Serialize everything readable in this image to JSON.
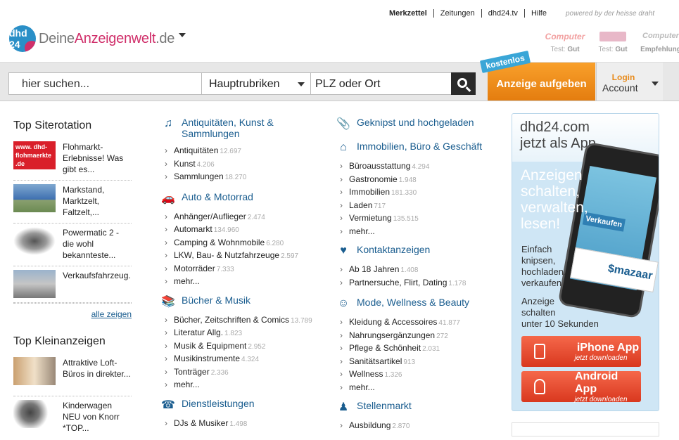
{
  "topnav": {
    "items": [
      "Merkzettel",
      "Zeitungen",
      "dhd24.tv",
      "Hilfe"
    ],
    "powered": "powered by der heisse draht"
  },
  "logo": {
    "badge": "dhd 24",
    "text_a": "Deine",
    "text_b": "Anzeigenwelt",
    "text_c": ".de"
  },
  "tests": [
    {
      "badge": "Computer",
      "label": "Test:",
      "rating": "Gut"
    },
    {
      "badge": "",
      "label": "Test:",
      "rating": "Gut"
    },
    {
      "badge": "Computer",
      "label": "",
      "rating": "Empfehlung"
    }
  ],
  "search": {
    "placeholder": "hier suchen...",
    "rubrik": "Hauptrubriken",
    "plz_placeholder": "PLZ oder Ort"
  },
  "cta": {
    "label": "Anzeige aufgeben",
    "badge": "kostenlos"
  },
  "login": {
    "line1": "Login",
    "line2": "Account"
  },
  "left": {
    "siterotation_title": "Top Siterotation",
    "siterotation": [
      {
        "text": "Flohmarkt-Erlebnisse! Was gibt es...",
        "thumb_text": "www. dhd-flohmaerkte .de"
      },
      {
        "text": "Markstand, Marktzelt, Faltzelt,...",
        "thumb_text": ""
      },
      {
        "text": "Powermatic 2 - die wohl bekannteste...",
        "thumb_text": ""
      },
      {
        "text": "Verkaufsfahrzeug.",
        "thumb_text": ""
      }
    ],
    "all_label": "alle zeigen",
    "klein_title": "Top Kleinanzeigen",
    "klein": [
      {
        "text": "Attraktive Loft-Büros in direkter..."
      },
      {
        "text": "Kinderwagen NEU von Knorr *TOP..."
      }
    ]
  },
  "col1": [
    {
      "title": "Antiquitäten, Kunst & Sammlungen",
      "icon": "gramophone-icon",
      "subs": [
        {
          "label": "Antiquitäten",
          "count": "12.697"
        },
        {
          "label": "Kunst",
          "count": "4.206"
        },
        {
          "label": "Sammlungen",
          "count": "18.270"
        }
      ]
    },
    {
      "title": "Auto & Motorrad",
      "icon": "car-icon",
      "subs": [
        {
          "label": "Anhänger/Auflieger",
          "count": "2.474"
        },
        {
          "label": "Automarkt",
          "count": "134.960"
        },
        {
          "label": "Camping & Wohnmobile",
          "count": "6.280"
        },
        {
          "label": "LKW, Bau- & Nutzfahrzeuge",
          "count": "2.597"
        },
        {
          "label": "Motorräder",
          "count": "7.333"
        },
        {
          "label": "mehr...",
          "count": ""
        }
      ]
    },
    {
      "title": "Bücher & Musik",
      "icon": "books-icon",
      "subs": [
        {
          "label": "Bücher, Zeitschriften & Comics",
          "count": "13.789"
        },
        {
          "label": "Literatur Allg.",
          "count": "1.823"
        },
        {
          "label": "Musik & Equipment",
          "count": "2.952"
        },
        {
          "label": "Musikinstrumente",
          "count": "4.324"
        },
        {
          "label": "Tonträger",
          "count": "2.336"
        },
        {
          "label": "mehr...",
          "count": ""
        }
      ]
    },
    {
      "title": "Dienstleistungen",
      "icon": "headset-icon",
      "subs": [
        {
          "label": "DJs & Musiker",
          "count": "1.498"
        }
      ]
    }
  ],
  "col2": [
    {
      "title": "Geknipst und hochgeladen",
      "icon": "paperclip-icon",
      "subs": []
    },
    {
      "title": "Immobilien, Büro & Geschäft",
      "icon": "house-icon",
      "subs": [
        {
          "label": "Büroausstattung",
          "count": "4.294"
        },
        {
          "label": "Gastronomie",
          "count": "1.948"
        },
        {
          "label": "Immobilien",
          "count": "181.330"
        },
        {
          "label": "Laden",
          "count": "717"
        },
        {
          "label": "Vermietung",
          "count": "135.515"
        },
        {
          "label": "mehr...",
          "count": ""
        }
      ]
    },
    {
      "title": "Kontaktanzeigen",
      "icon": "heart-icon",
      "subs": [
        {
          "label": "Ab 18 Jahren",
          "count": "1.408"
        },
        {
          "label": "Partnersuche, Flirt, Dating",
          "count": "1.178"
        }
      ]
    },
    {
      "title": "Mode, Wellness & Beauty",
      "icon": "meditation-icon",
      "subs": [
        {
          "label": "Kleidung & Accessoires",
          "count": "41.877"
        },
        {
          "label": "Nahrungsergänzungen",
          "count": "272"
        },
        {
          "label": "Pflege & Schönheit",
          "count": "2.031"
        },
        {
          "label": "Sanitätsartikel",
          "count": "913"
        },
        {
          "label": "Wellness",
          "count": "1.326"
        },
        {
          "label": "mehr...",
          "count": ""
        }
      ]
    },
    {
      "title": "Stellenmarkt",
      "icon": "worker-icon",
      "subs": [
        {
          "label": "Ausbildung",
          "count": "2.870"
        }
      ]
    }
  ],
  "app": {
    "title_1": "dhd24.com",
    "title_2": "jetzt als App",
    "big": [
      "Anzeigen",
      "schalten,",
      "verwalten,",
      "lesen!"
    ],
    "small": [
      "Einfach",
      "knipsen,",
      "hochladen,",
      "verkaufen"
    ],
    "small2": [
      "Anzeige",
      "schalten",
      "unter 10 Sekunden"
    ],
    "screen_label": "Verkaufen",
    "mazaar": "$mazaar",
    "iphone": {
      "title": "iPhone App",
      "sub": "jetzt downloaden"
    },
    "android": {
      "title": "Android App",
      "sub": "jetzt downloaden"
    }
  }
}
